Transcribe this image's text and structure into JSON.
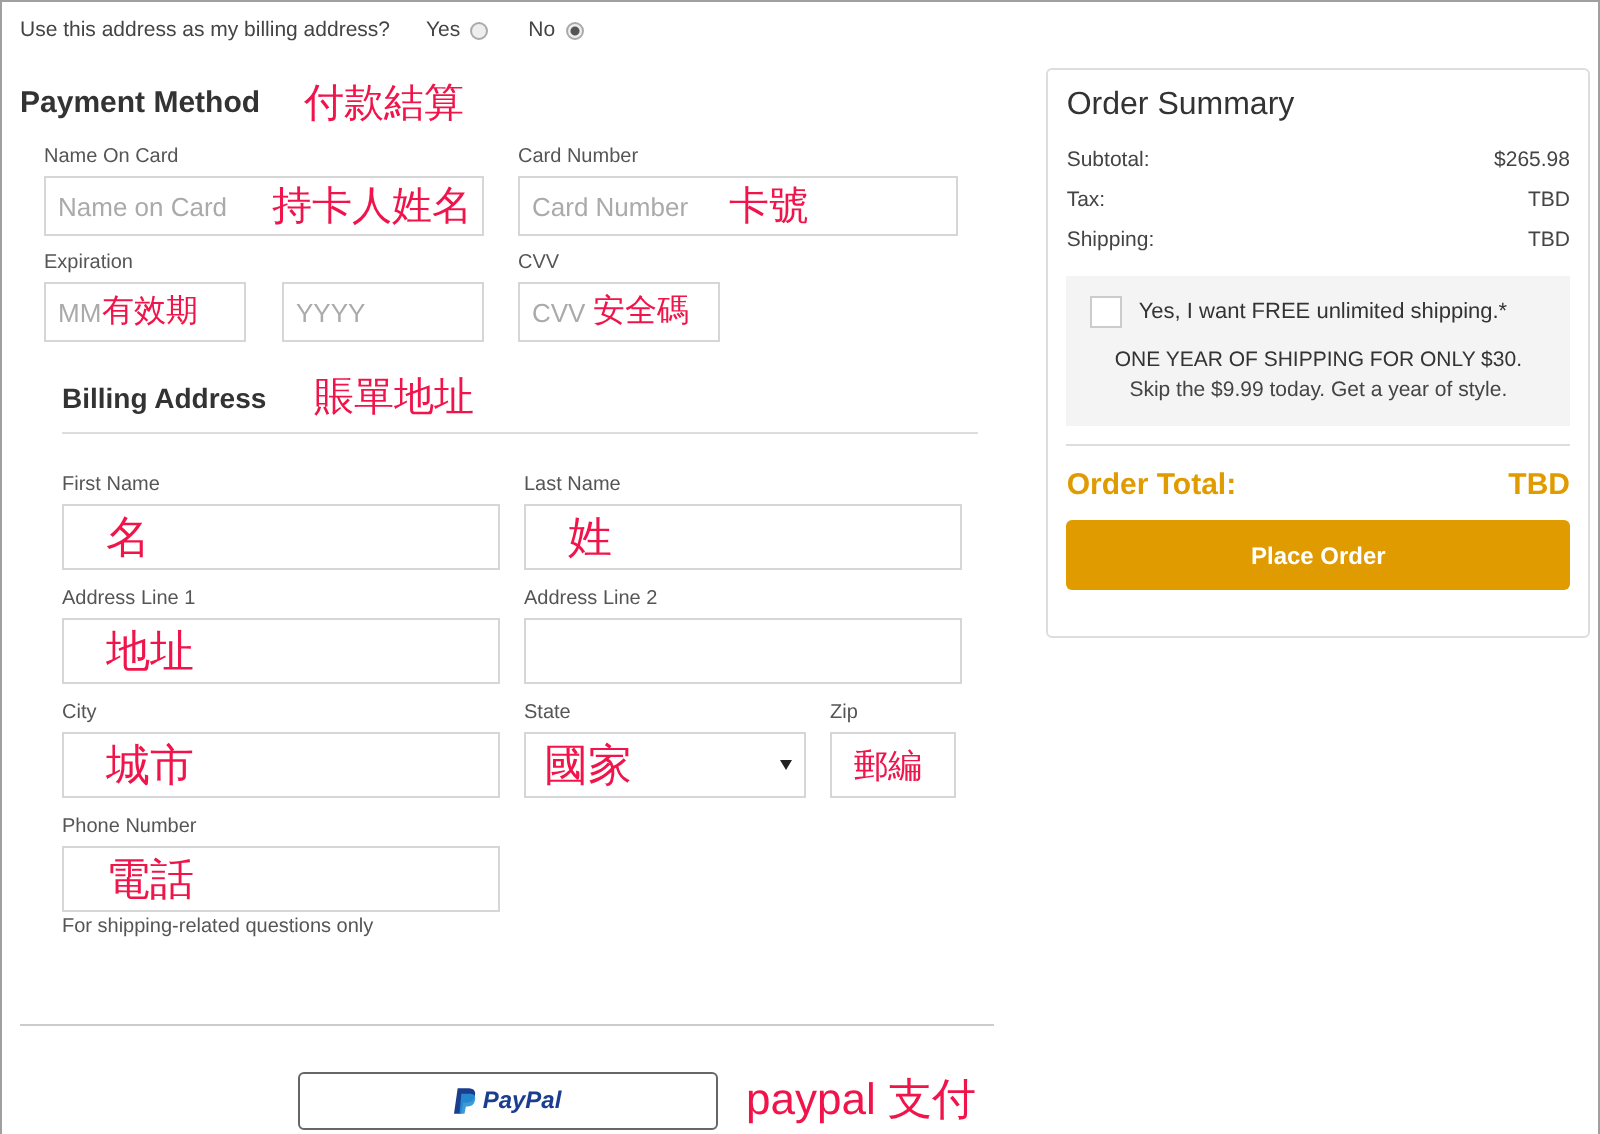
{
  "billing_question": {
    "label": "Use this address as my billing address?",
    "options": [
      {
        "label": "Yes",
        "selected": false
      },
      {
        "label": "No",
        "selected": true
      }
    ]
  },
  "payment_method": {
    "title": "Payment Method",
    "annotation": "付款結算",
    "rows": [
      {
        "groups": [
          {
            "label": "Name On Card",
            "inputs": [
              {
                "placeholder": "Name on Card",
                "annotation": "持卡人姓名"
              }
            ]
          },
          {
            "label": "Card Number",
            "inputs": [
              {
                "placeholder": "Card Number",
                "annotation": "卡號"
              }
            ]
          }
        ]
      },
      {
        "groups": [
          {
            "label": "Expiration",
            "inputs": [
              {
                "placeholder": "MM",
                "annotation": "有效期"
              },
              {
                "placeholder": "YYYY"
              }
            ]
          },
          {
            "label": "CVV",
            "inputs": [
              {
                "placeholder": "CVV",
                "annotation": "安全碼"
              }
            ]
          }
        ]
      }
    ]
  },
  "billing_address": {
    "title": "Billing Address",
    "annotation": "賬單地址",
    "rows": [
      {
        "groups": [
          {
            "label": "First Name",
            "inputs": [
              {
                "kind": "text",
                "annotation": "名"
              }
            ]
          },
          {
            "label": "Last Name",
            "inputs": [
              {
                "kind": "text",
                "annotation": "姓"
              }
            ]
          }
        ]
      },
      {
        "groups": [
          {
            "label": "Address Line 1",
            "inputs": [
              {
                "kind": "text",
                "annotation": "地址"
              }
            ]
          },
          {
            "label": "Address Line 2",
            "inputs": [
              {
                "kind": "text"
              }
            ]
          }
        ]
      },
      {
        "groups": [
          {
            "label": "City",
            "inputs": [
              {
                "kind": "text",
                "annotation": "城市"
              }
            ]
          },
          {
            "label": "State",
            "inputs": [
              {
                "kind": "select",
                "annotation": "國家"
              }
            ]
          },
          {
            "label": "Zip",
            "inputs": [
              {
                "kind": "text",
                "annotation": "郵編"
              }
            ]
          }
        ]
      },
      {
        "groups": [
          {
            "label": "Phone Number",
            "inputs": [
              {
                "kind": "text",
                "annotation": "電話"
              }
            ],
            "help": "For shipping-related questions only"
          }
        ]
      }
    ]
  },
  "paypal": {
    "label": "PayPal",
    "annotation": "paypal 支付"
  },
  "order_summary": {
    "title": "Order Summary",
    "rows": [
      {
        "label": "Subtotal:",
        "value": "$265.98"
      },
      {
        "label": "Tax:",
        "value": "TBD"
      },
      {
        "label": "Shipping:",
        "value": "TBD"
      }
    ],
    "promo": {
      "checked": false,
      "label": "Yes, I want FREE unlimited shipping.*",
      "headline": "ONE YEAR OF SHIPPING FOR ONLY $30.",
      "text": "Skip the $9.99 today. Get a year of style."
    },
    "total": {
      "label": "Order Total:",
      "value": "TBD"
    },
    "button": "Place Order"
  }
}
